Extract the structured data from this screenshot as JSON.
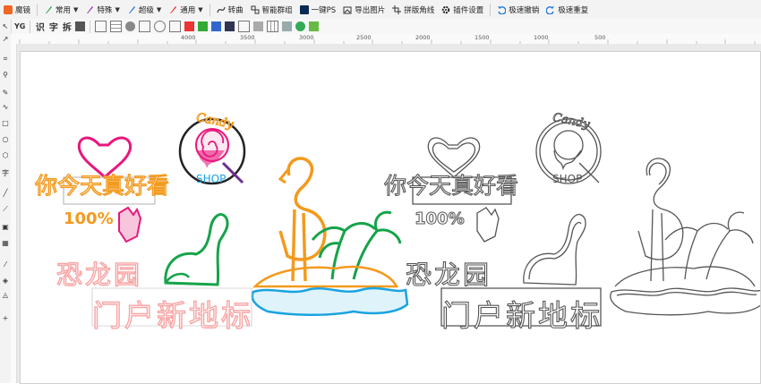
{
  "app": {
    "title": "魔镜"
  },
  "menu": [
    {
      "label": "常用",
      "icon": "pen-icon",
      "dropdown": true
    },
    {
      "label": "特殊",
      "icon": "pen-icon",
      "dropdown": true
    },
    {
      "label": "超级",
      "icon": "pen-icon",
      "dropdown": true
    },
    {
      "label": "通用",
      "icon": "pen-icon",
      "dropdown": true
    },
    {
      "label": "转曲",
      "icon": "curve-icon",
      "dropdown": false
    },
    {
      "label": "智能群组",
      "icon": "group-icon",
      "dropdown": false
    },
    {
      "label": "一键PS",
      "icon": "ps-icon",
      "dropdown": false
    },
    {
      "label": "导出图片",
      "icon": "export-image-icon",
      "dropdown": false
    },
    {
      "label": "拼版角线",
      "icon": "crop-marks-icon",
      "dropdown": false
    },
    {
      "label": "插件设置",
      "icon": "gear-icon",
      "dropdown": false
    },
    {
      "label": "极速撤销",
      "icon": "undo-icon",
      "dropdown": false
    },
    {
      "label": "极速重复",
      "icon": "redo-icon",
      "dropdown": false
    }
  ],
  "toolbar2": {
    "chars": [
      "识",
      "字",
      "拆"
    ]
  },
  "ruler": {
    "labels": [
      "4000",
      "3500",
      "3000",
      "2500",
      "2000",
      "1500",
      "1000",
      "500"
    ]
  },
  "artwork": {
    "heart_text": "你今天真好看",
    "percent_text": "100%",
    "candy_text": "Candy",
    "shop_text": "SHOP",
    "park_text": "恐龙园",
    "sign_text": "门户新地标"
  },
  "colors": {
    "accent": "#1e78d7",
    "pink": "#e8177d",
    "orange": "#f39a1e",
    "blue": "#1aa3e0",
    "green": "#16a34a",
    "salmon": "#f7a5a5",
    "purple": "#6c2d91",
    "outline": "#555555"
  }
}
